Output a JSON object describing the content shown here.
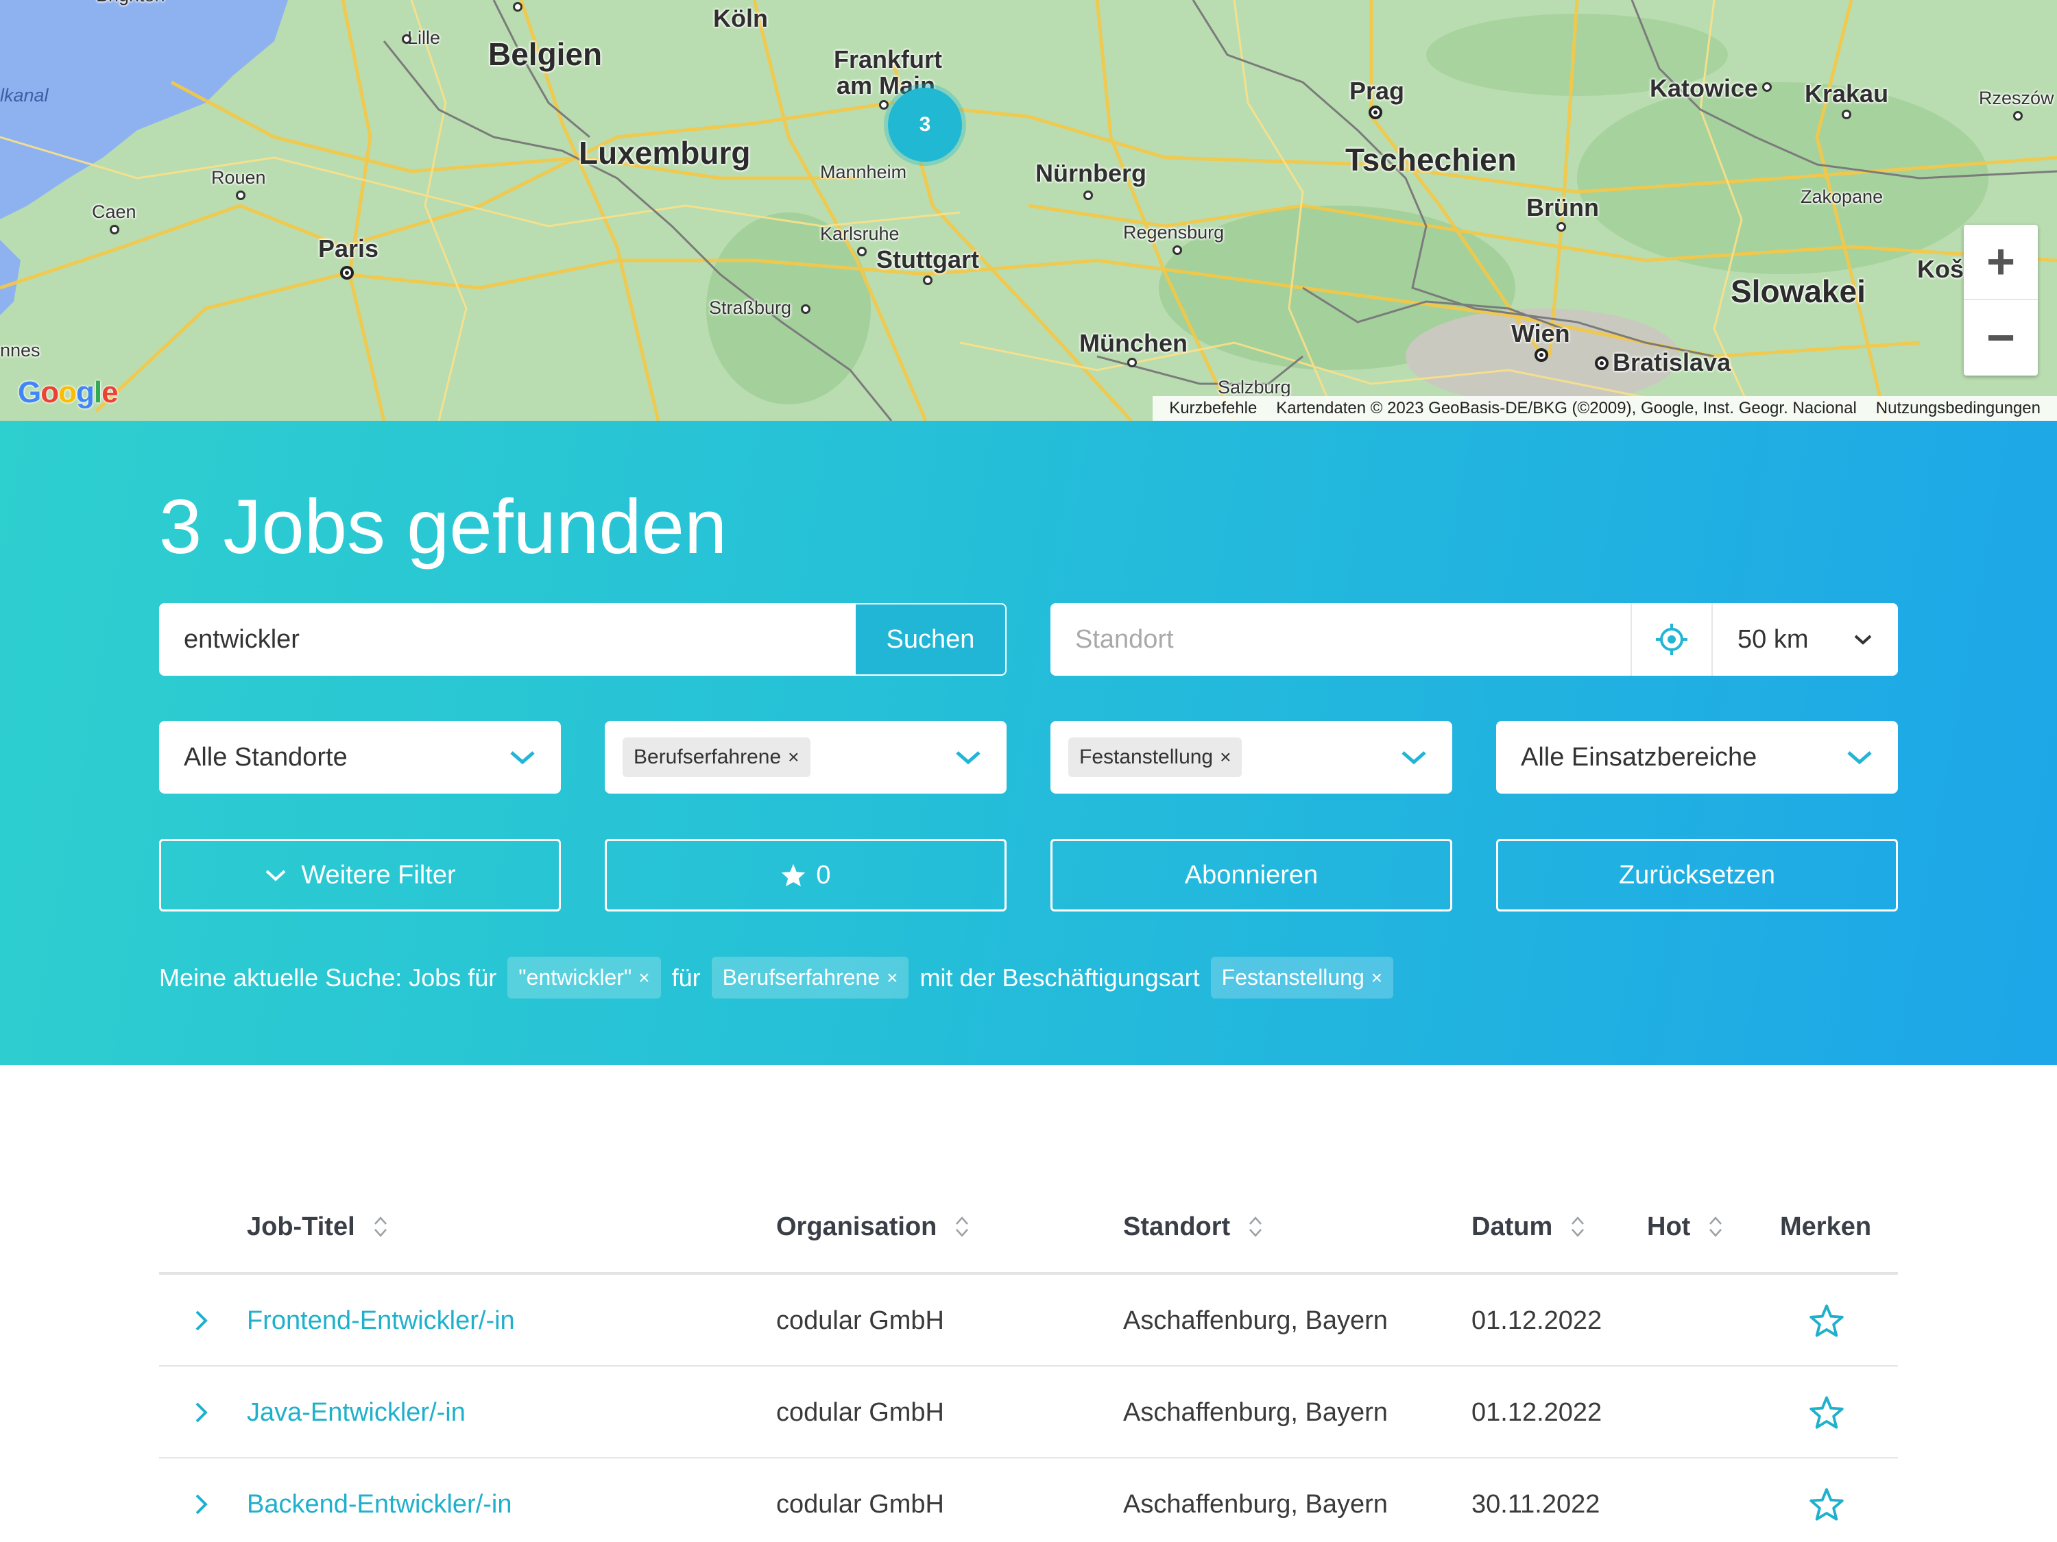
{
  "map": {
    "cluster_count": "3",
    "zoom_in": "+",
    "zoom_out": "−",
    "logo": [
      "G",
      "o",
      "o",
      "g",
      "l",
      "e"
    ],
    "attribution": {
      "shortcuts": "Kurzbefehle",
      "data": "Kartendaten © 2023 GeoBasis-DE/BKG (©2009), Google, Inst. Geogr. Nacional",
      "terms": "Nutzungsbedingungen"
    },
    "labels": {
      "koeln": "Köln",
      "frankfurt1": "Frankfurt",
      "frankfurt2": "am Main",
      "lille": "Lille",
      "belgien": "Belgien",
      "luxemburg": "Luxemburg",
      "mannheim": "Mannheim",
      "nuernberg": "Nürnberg",
      "prag": "Prag",
      "tschechien": "Tschechien",
      "katowice": "Katowice",
      "krakau": "Krakau",
      "rzeszow": "Rzeszów",
      "rouen": "Rouen",
      "caen": "Caen",
      "paris": "Paris",
      "karlsruhe": "Karlsruhe",
      "stuttgart": "Stuttgart",
      "regensburg": "Regensburg",
      "bruenn": "Brünn",
      "zakopane": "Zakopane",
      "slowakei": "Slowakei",
      "kos": "Koš",
      "strassburg": "Straßburg",
      "muenchen": "München",
      "wien": "Wien",
      "bratislava": "Bratislava",
      "salzburg": "Salzburg",
      "kanal": "lkanal",
      "nnes": "nnes",
      "brighton": "Brighton"
    },
    "colors": {
      "land": "#b7dcb0",
      "sea": "#8eb2f0",
      "roads": "#f5c842",
      "borders": "#7a7a7a"
    }
  },
  "search": {
    "title": "3 Jobs gefunden",
    "query_value": "entwickler",
    "search_button": "Suchen",
    "location_placeholder": "Standort",
    "radius": "50 km",
    "dropdowns": {
      "standorte": "Alle Standorte",
      "level_chip": "Berufserfahrene",
      "type_chip": "Festanstellung",
      "bereich": "Alle Einsatzbereiche"
    },
    "buttons": {
      "more_filters": "Weitere Filter",
      "favorites_count": "0",
      "subscribe": "Abonnieren",
      "reset": "Zurücksetzen"
    },
    "summary": {
      "prefix": "Meine aktuelle Suche: Jobs für",
      "query_tag": "\"entwickler\"",
      "for": "für",
      "level_tag": "Berufserfahrene",
      "with_type": "mit der Beschäftigungsart",
      "type_tag": "Festanstellung"
    },
    "chip_remove": "×"
  },
  "table": {
    "headers": {
      "title": "Job-Titel",
      "org": "Organisation",
      "location": "Standort",
      "date": "Datum",
      "hot": "Hot",
      "save": "Merken"
    },
    "rows": [
      {
        "title": "Frontend-Entwickler/-in",
        "org": "codular GmbH",
        "location": "Aschaffenburg, Bayern",
        "date": "01.12.2022"
      },
      {
        "title": "Java-Entwickler/-in",
        "org": "codular GmbH",
        "location": "Aschaffenburg, Bayern",
        "date": "01.12.2022"
      },
      {
        "title": "Backend-Entwickler/-in",
        "org": "codular GmbH",
        "location": "Aschaffenburg, Bayern",
        "date": "30.11.2022"
      }
    ]
  },
  "colors": {
    "accent": "#21b6d6",
    "link": "#1fb0cc",
    "panel_start": "#2ecfcf",
    "panel_end": "#1da6e8"
  }
}
